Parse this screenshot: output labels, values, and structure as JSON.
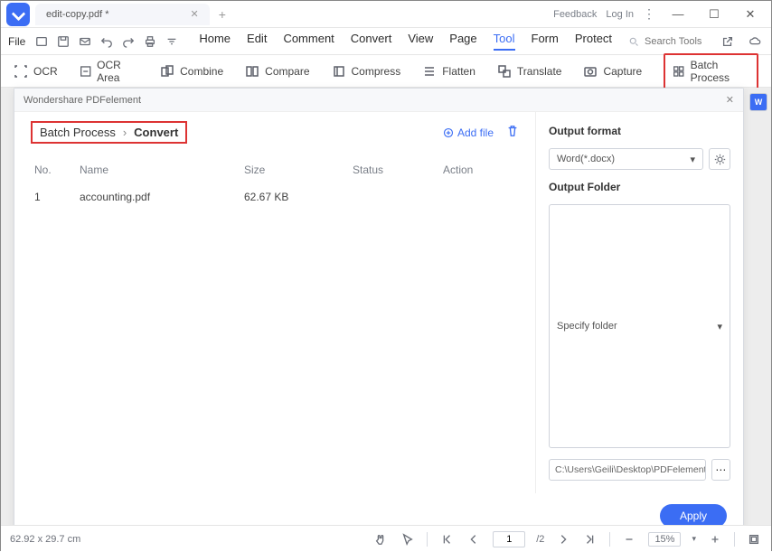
{
  "titlebar": {
    "tab_name": "edit-copy.pdf *",
    "feedback": "Feedback",
    "login": "Log In"
  },
  "menubar": {
    "file": "File",
    "items": [
      "Home",
      "Edit",
      "Comment",
      "Convert",
      "View",
      "Page",
      "Tool",
      "Form",
      "Protect"
    ],
    "active_index": 6,
    "search_placeholder": "Search Tools"
  },
  "ribbon": {
    "ocr": "OCR",
    "ocr_area": "OCR Area",
    "combine": "Combine",
    "compare": "Compare",
    "compress": "Compress",
    "flatten": "Flatten",
    "translate": "Translate",
    "capture": "Capture",
    "batch": "Batch Process"
  },
  "dialog": {
    "title": "Wondershare PDFelement",
    "breadcrumb_root": "Batch Process",
    "breadcrumb_current": "Convert",
    "add_file": "Add file",
    "columns": {
      "no": "No.",
      "name": "Name",
      "size": "Size",
      "status": "Status",
      "action": "Action"
    },
    "rows": [
      {
        "no": "1",
        "name": "accounting.pdf",
        "size": "62.67 KB",
        "status": "",
        "action": ""
      }
    ],
    "output_format_label": "Output format",
    "output_format_value": "Word(*.docx)",
    "output_folder_label": "Output Folder",
    "folder_placeholder": "Specify folder",
    "folder_path": "C:\\Users\\Geili\\Desktop\\PDFelement\\Cc",
    "apply": "Apply"
  },
  "statusbar": {
    "size": "62.92 x 29.7 cm",
    "page": "1",
    "pages": "/2",
    "zoom": "15%"
  }
}
